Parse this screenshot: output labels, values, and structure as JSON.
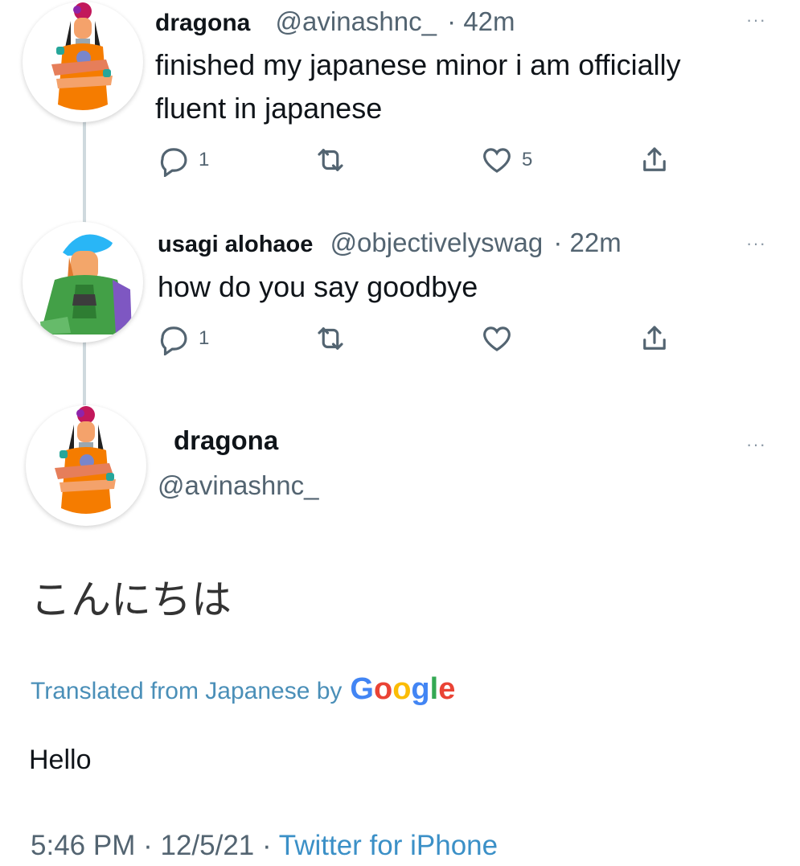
{
  "tweets": [
    {
      "name": "dragona",
      "handle": "@avinashnc_",
      "time": "· 42m",
      "text_lines": [
        "finished my japanese minor i am officially",
        "fluent in japanese"
      ],
      "reply_count": "1",
      "retweet_count": "",
      "like_count": "5",
      "more": "···"
    },
    {
      "name": "usagi alohaoe",
      "handle": "@objectivelyswag",
      "time": "· 22m",
      "text_lines": [
        "how do you say goodbye"
      ],
      "reply_count": "1",
      "retweet_count": "",
      "like_count": "",
      "more": "···"
    }
  ],
  "main_tweet": {
    "name": "dragona",
    "handle": "@avinashnc_",
    "more": "···",
    "text": "こんにちは",
    "translated_label": "Translated from Japanese by",
    "google": {
      "letters": [
        "G",
        "o",
        "o",
        "g",
        "l",
        "e"
      ],
      "colors": [
        "#4285F4",
        "#EA4335",
        "#FBBC05",
        "#4285F4",
        "#34A853",
        "#EA4335"
      ]
    },
    "translation": "Hello",
    "time": "5:46 PM",
    "date": "12/5/21",
    "source": "Twitter for iPhone"
  },
  "colors": {
    "text": "#0f1419",
    "muted": "#536471",
    "link": "#1d9bf0",
    "thread_line": "#cfd9de"
  },
  "icons": [
    "reply-icon",
    "retweet-icon",
    "like-icon",
    "share-icon",
    "more-icon"
  ]
}
